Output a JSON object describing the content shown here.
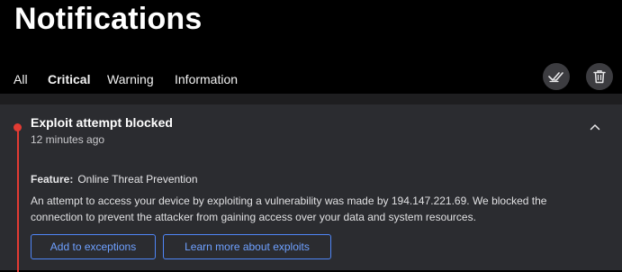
{
  "header": {
    "title": "Notifications"
  },
  "tabs": [
    {
      "label": "All",
      "active": false
    },
    {
      "label": "Critical",
      "active": true
    },
    {
      "label": "Warning",
      "active": false
    },
    {
      "label": "Information",
      "active": false
    }
  ],
  "toolbar": {
    "mark_all_read_icon": "double-check-icon",
    "delete_icon": "trash-icon"
  },
  "notification": {
    "title": "Exploit attempt blocked",
    "time": "12 minutes ago",
    "severity_color": "#e23b33",
    "feature_label": "Feature:",
    "feature_value": "Online Threat Prevention",
    "description": "An attempt to access your device by exploiting a vulnerability was made by 194.147.221.69. We blocked the connection to prevent the attacker from gaining access over your data and system resources.",
    "actions": [
      {
        "label": "Add to exceptions"
      },
      {
        "label": "Learn more about exploits"
      }
    ]
  },
  "colors": {
    "accent": "#4ea0ff",
    "button_border": "#4f86f7",
    "card_bg": "#2b2c30",
    "page_bg": "#000000"
  }
}
